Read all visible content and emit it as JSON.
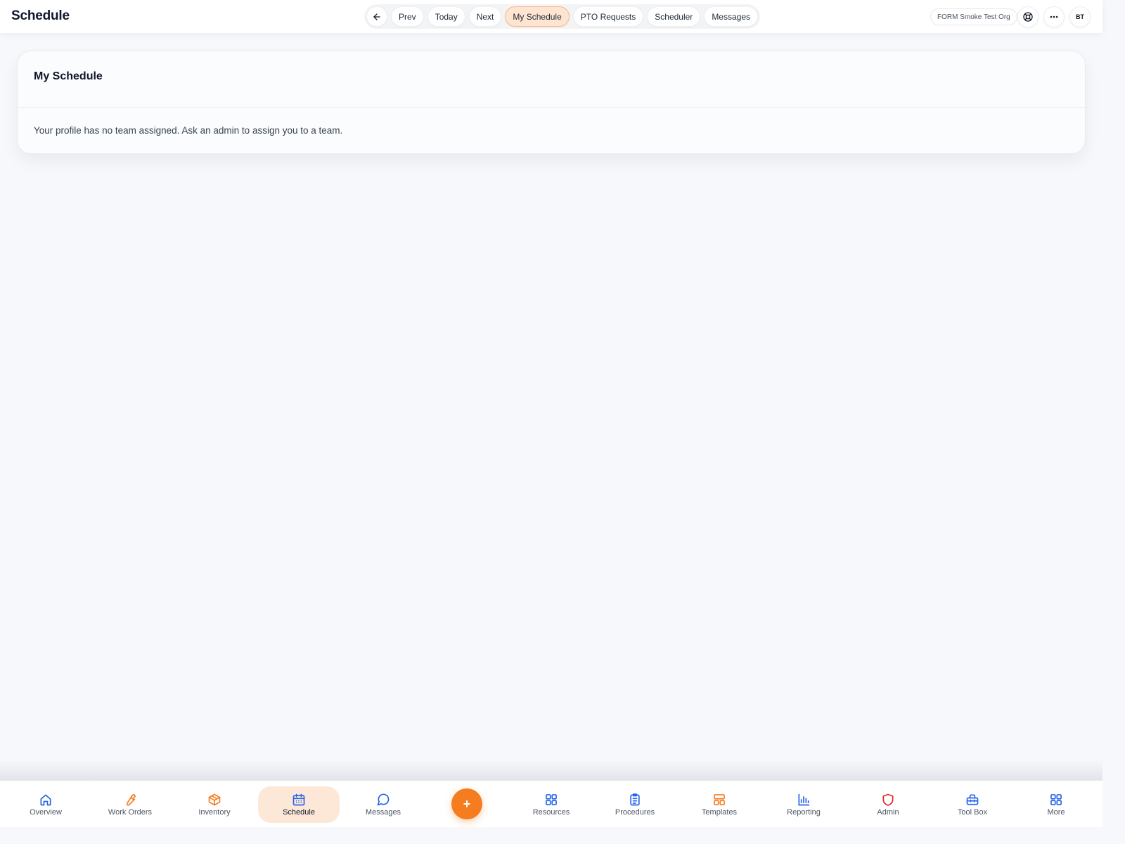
{
  "header": {
    "title": "Schedule",
    "nav": {
      "back_icon": "arrow-left-icon",
      "buttons": [
        "Prev",
        "Today",
        "Next",
        "My Schedule",
        "PTO Requests",
        "Scheduler",
        "Messages"
      ],
      "active": "My Schedule"
    },
    "org": "FORM Smoke Test Org",
    "help_icon": "lifebuoy-icon",
    "more_icon": "more-horizontal-icon",
    "avatar": "BT"
  },
  "card": {
    "title": "My Schedule",
    "message": "Your profile has no team assigned. Ask an admin to assign you to a team."
  },
  "bottom_nav": {
    "items": [
      {
        "label": "Overview",
        "icon": "home-icon",
        "color": "#2563eb"
      },
      {
        "label": "Work Orders",
        "icon": "wrench-icon",
        "color": "#f57c1f"
      },
      {
        "label": "Inventory",
        "icon": "package-icon",
        "color": "#f57c1f"
      },
      {
        "label": "Schedule",
        "icon": "calendar-icon",
        "color": "#2563eb"
      },
      {
        "label": "Messages",
        "icon": "message-circle-icon",
        "color": "#2563eb"
      },
      {
        "label": "Resources",
        "icon": "grid-icon",
        "color": "#2563eb"
      },
      {
        "label": "Procedures",
        "icon": "clipboard-list-icon",
        "color": "#2563eb"
      },
      {
        "label": "Templates",
        "icon": "layout-icon",
        "color": "#f57c1f"
      },
      {
        "label": "Reporting",
        "icon": "bar-chart-icon",
        "color": "#2563eb"
      },
      {
        "label": "Admin",
        "icon": "shield-icon",
        "color": "#dc2626"
      },
      {
        "label": "Tool Box",
        "icon": "toolbox-icon",
        "color": "#2563eb"
      },
      {
        "label": "More",
        "icon": "grid-icon",
        "color": "#2563eb"
      }
    ],
    "active": "Schedule",
    "fab_label": "+"
  },
  "colors": {
    "accent": "#f57c1f",
    "accent_soft": "#fde5d2",
    "icon_blue": "#2563eb",
    "icon_red": "#dc2626",
    "background": "#f7f8fb"
  }
}
